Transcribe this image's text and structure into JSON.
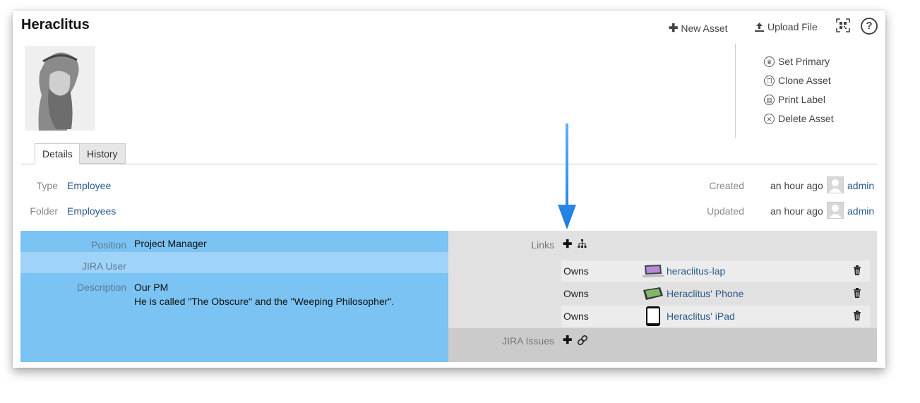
{
  "header": {
    "title": "Heraclitus",
    "new_asset": "New Asset",
    "upload_file": "Upload File",
    "help": "?"
  },
  "actions": {
    "set_primary": "Set Primary",
    "clone_asset": "Clone Asset",
    "print_label": "Print Label",
    "delete_asset": "Delete Asset"
  },
  "tabs": {
    "details": "Details",
    "history": "History"
  },
  "meta": {
    "type_label": "Type",
    "type_value": "Employee",
    "folder_label": "Folder",
    "folder_value": "Employees",
    "created_label": "Created",
    "created_time": "an hour ago",
    "created_user": "admin",
    "updated_label": "Updated",
    "updated_time": "an hour ago",
    "updated_user": "admin"
  },
  "fields": {
    "position_label": "Position",
    "position_value": "Project Manager",
    "jira_user_label": "JIRA User",
    "jira_user_value": "",
    "description_label": "Description",
    "description_line1": "Our PM",
    "description_line2": "He is called \"The Obscure\" and the \"Weeping Philosopher\"."
  },
  "links": {
    "label": "Links",
    "rows": [
      {
        "relation": "Owns",
        "name": "heraclitus-lap",
        "icon": "laptop-thumbnail"
      },
      {
        "relation": "Owns",
        "name": "Heraclitus' Phone",
        "icon": "phone-thumbnail"
      },
      {
        "relation": "Owns",
        "name": "Heraclitus' iPad",
        "icon": "tablet-thumbnail"
      }
    ]
  },
  "jira": {
    "label": "JIRA Issues"
  },
  "colors": {
    "left_panel": "#7ac3f3",
    "left_panel_alt": "#9fd3f8",
    "right_panel": "#e1e1e1",
    "right_panel_bottom": "#cbcbcb",
    "link": "#2a5a8a",
    "annotation_arrow": "#1a7be0"
  }
}
